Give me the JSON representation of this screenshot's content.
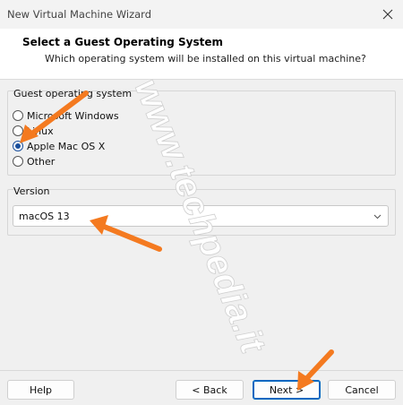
{
  "window": {
    "title": "New Virtual Machine Wizard"
  },
  "header": {
    "title": "Select a Guest Operating System",
    "subtitle": "Which operating system will be installed on this virtual machine?"
  },
  "guest_os": {
    "legend": "Guest operating system",
    "options": [
      {
        "label": "Microsoft Windows",
        "checked": false
      },
      {
        "label": "Linux",
        "checked": false
      },
      {
        "label": "Apple Mac OS X",
        "checked": true
      },
      {
        "label": "Other",
        "checked": false
      }
    ]
  },
  "version": {
    "legend": "Version",
    "selected": "macOS 13"
  },
  "buttons": {
    "help": "Help",
    "back": "< Back",
    "next": "Next >",
    "cancel": "Cancel"
  },
  "watermark": {
    "text": "www.techpedia.it"
  },
  "colors": {
    "accent": "#1a4f9c",
    "annotation_arrow": "#f47a20",
    "watermark": "#ffffff"
  }
}
